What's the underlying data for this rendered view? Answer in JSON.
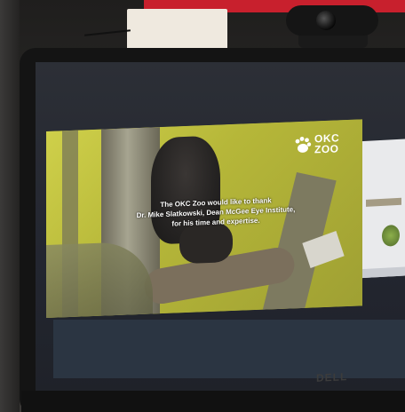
{
  "video": {
    "caption_lines": [
      "The OKC Zoo would like to thank",
      "Dr. Mike Slatkowski, Dean McGee Eye Institute,",
      "for his time and expertise."
    ],
    "logo_line1": "OKC",
    "logo_line2": "ZOO"
  },
  "monitor": {
    "brand": "DELL"
  },
  "colors": {
    "banner_red": "#c8202d",
    "video_background": "#b9ba40",
    "screen_blue": "#2b3542"
  }
}
